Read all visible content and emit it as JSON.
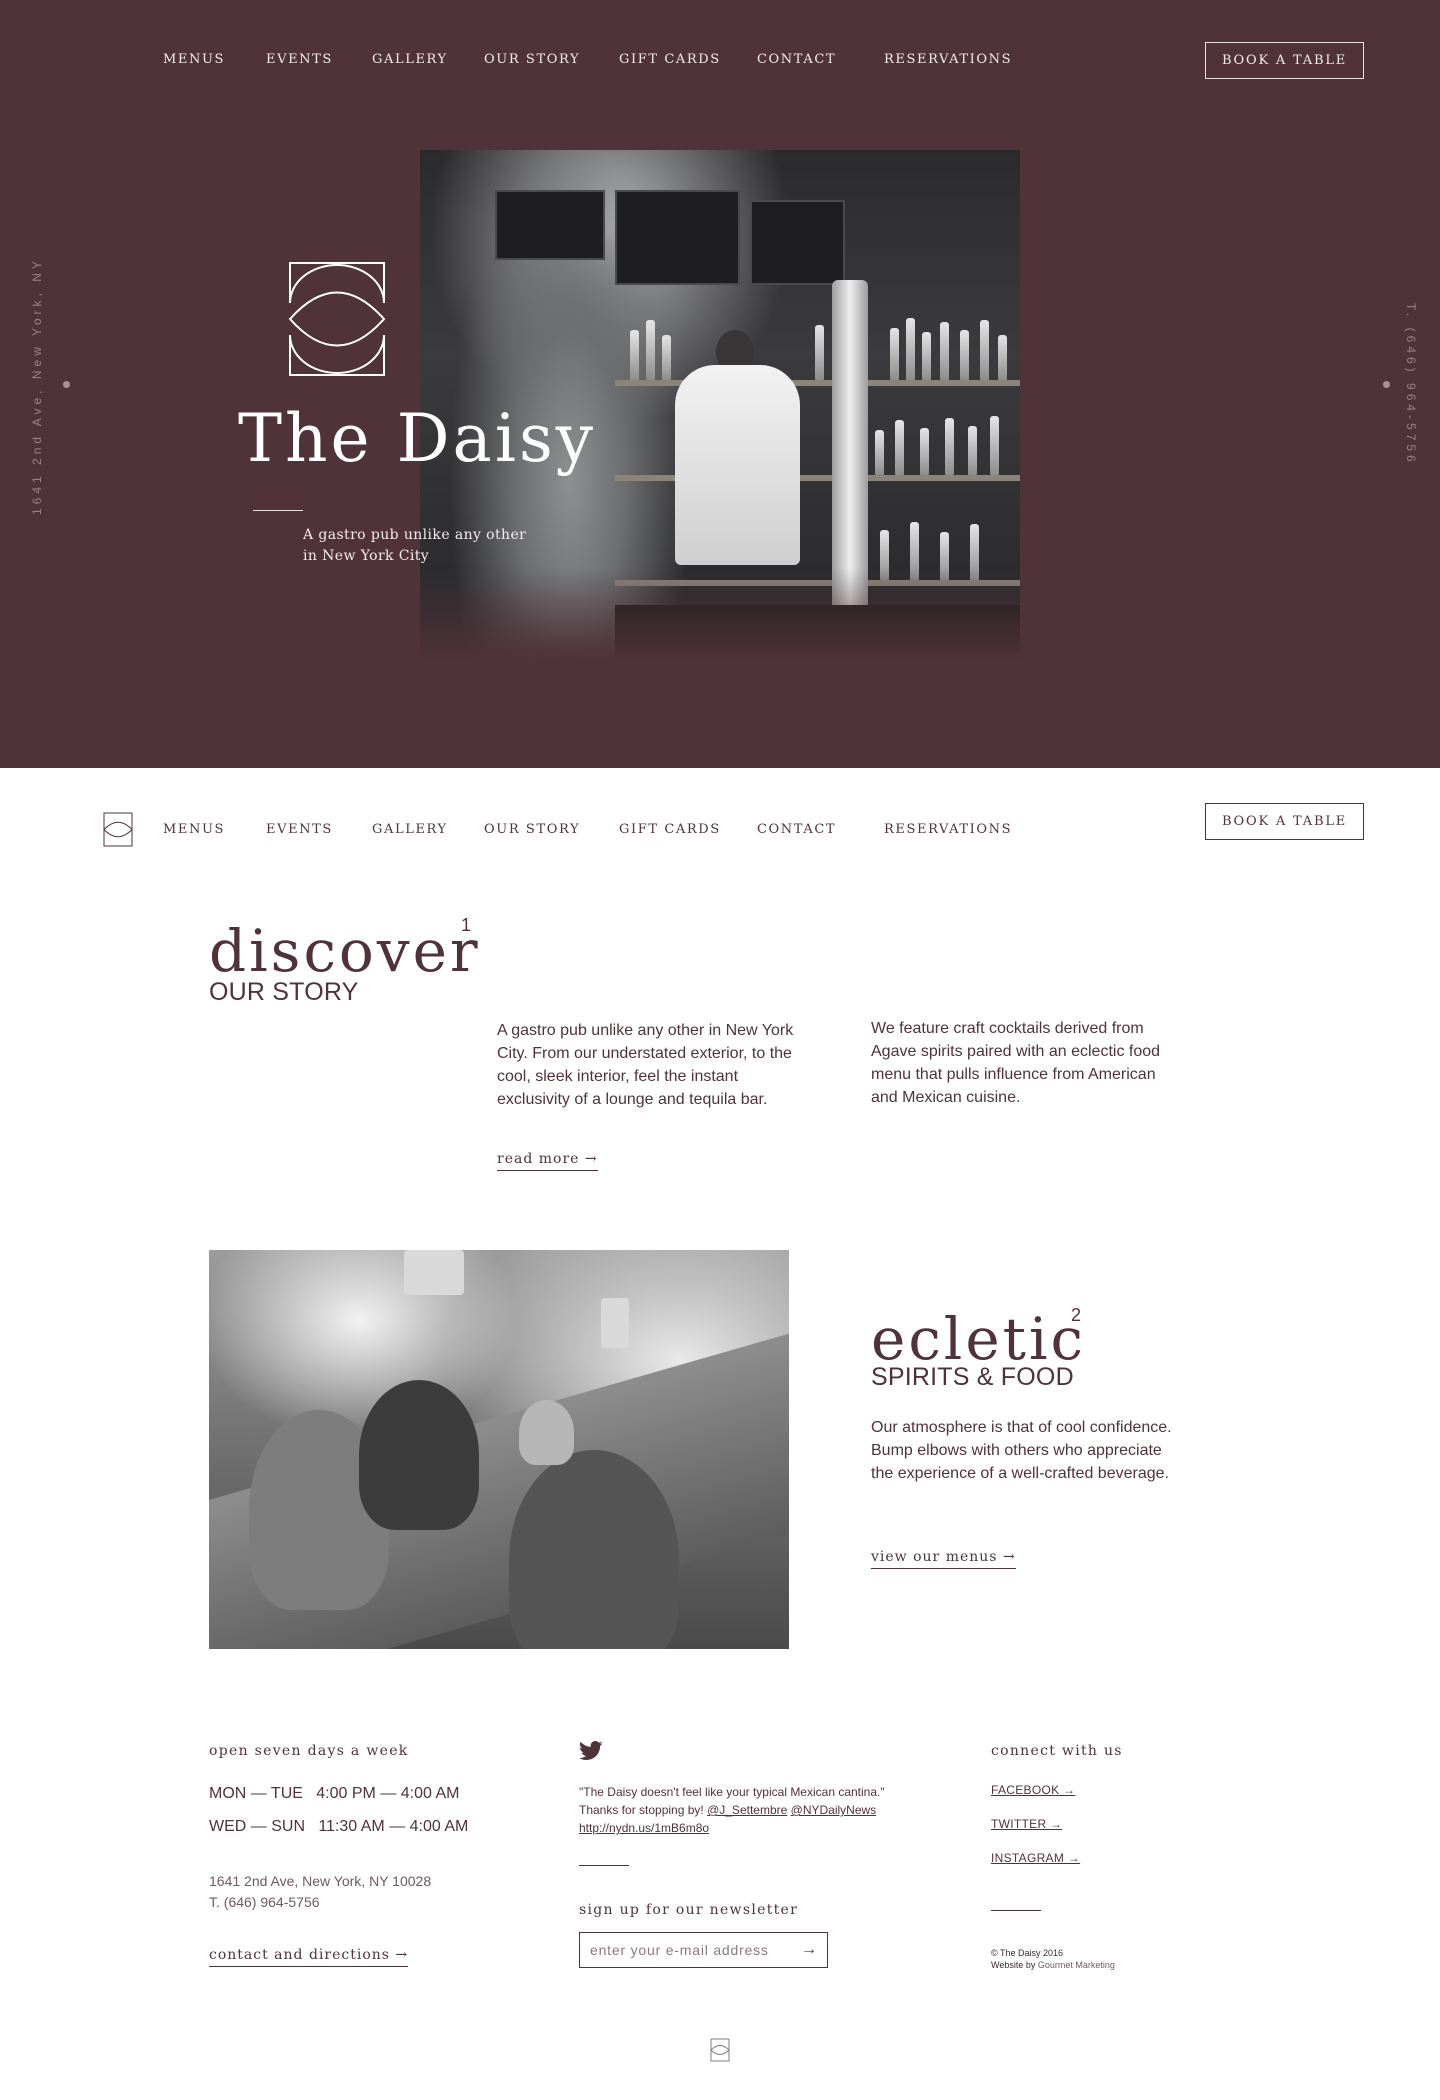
{
  "nav": {
    "items": [
      "MENUS",
      "EVENTS",
      "GALLERY",
      "OUR STORY",
      "GIFT CARDS",
      "CONTACT",
      "RESERVATIONS"
    ],
    "book_label": "BOOK A TABLE"
  },
  "hero": {
    "title": "The Daisy",
    "tagline_line1": "A gastro pub unlike any other",
    "tagline_line2": "in New York City",
    "side_address": "1641 2nd Ave, New York, NY",
    "side_phone": "T. (646) 964-5756"
  },
  "discover": {
    "word": "discover",
    "number": "1",
    "subtitle": "OUR STORY",
    "para1": "A gastro pub unlike any other in New York City. From our understated exterior, to the cool, sleek interior, feel the instant exclusivity of a lounge and tequila bar.",
    "para2": "We feature craft cocktails derived from Agave spirits paired with an eclectic food menu that pulls influence from American and Mexican cuisine.",
    "link": "read more →"
  },
  "eclectic": {
    "word": "ecletic",
    "number": "2",
    "subtitle": "SPIRITS & FOOD",
    "para": "Our atmosphere is that of cool confidence. Bump elbows with others who appreciate the experience of a well-crafted beverage.",
    "link": "view our menus →"
  },
  "footer": {
    "hours_heading": "open seven days a week",
    "hours": [
      {
        "days": "MON — TUE",
        "open": "4:00 PM",
        "close": "4:00 AM"
      },
      {
        "days": "WED — SUN",
        "open": "11:30 AM",
        "close": "4:00 AM"
      }
    ],
    "address": "1641 2nd Ave, New York, NY 10028",
    "phone": "T. (646) 964-5756",
    "directions": "contact and directions →",
    "tweet_quote": "\"The Daisy doesn't feel like your typical Mexican cantina.\"",
    "tweet_thanks": "Thanks for stopping by!",
    "tweet_handle1": "@J_Settembre",
    "tweet_handle2": "@NYDailyNews",
    "tweet_link": "http://nydn.us/1mB6m8o",
    "newsletter_heading": "sign up for our newsletter",
    "newsletter_placeholder": "enter your e-mail address",
    "newsletter_submit": "→",
    "connect_heading": "connect with us",
    "social": [
      "FACEBOOK →",
      "TWITTER →",
      "INSTAGRAM →"
    ],
    "copyright": "© The Daisy 2016",
    "website_by_label": "Website by",
    "website_by": "Gourmet Marketing"
  },
  "colors": {
    "brand": "#4f3339",
    "text_light": "#f3ecee",
    "background": "#ffffff"
  },
  "icons": [
    "daisy-logo-icon",
    "twitter-icon",
    "arrow-right-icon"
  ]
}
